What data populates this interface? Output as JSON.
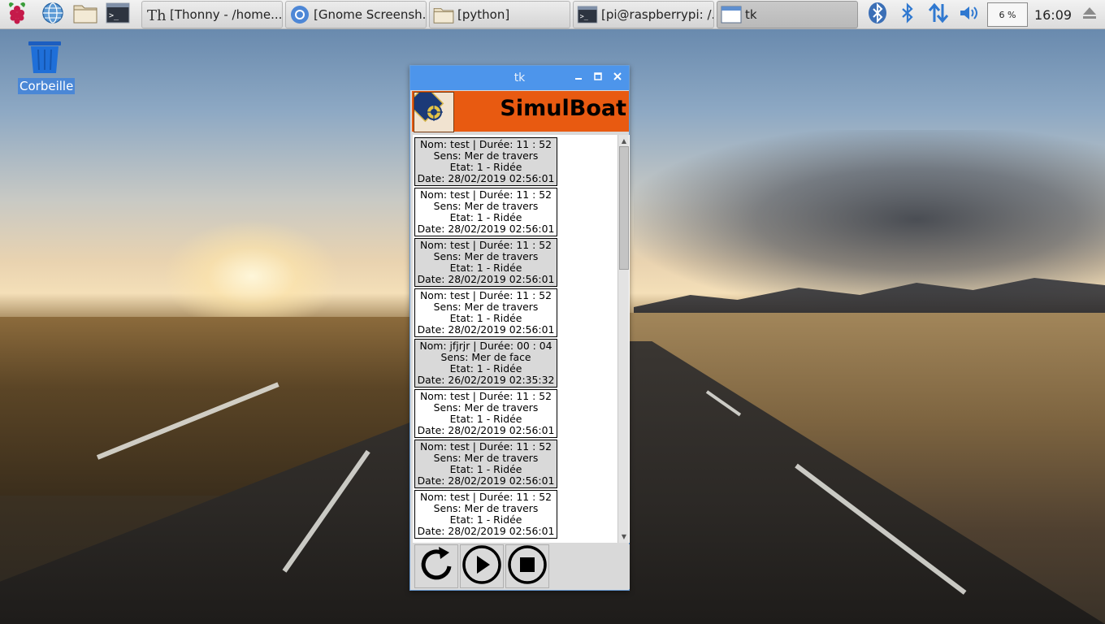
{
  "taskbar": {
    "launchers": [
      {
        "name": "raspberry-menu",
        "icon": "raspberry-icon"
      },
      {
        "name": "web-browser",
        "icon": "globe-icon"
      },
      {
        "name": "file-manager",
        "icon": "folder-icon"
      },
      {
        "name": "terminal",
        "icon": "terminal-icon"
      }
    ],
    "tasks": [
      {
        "label": "[Thonny  -  /home...",
        "icon": "thonny-icon"
      },
      {
        "label": "[Gnome Screensh...",
        "icon": "chromium-icon"
      },
      {
        "label": "[python]",
        "icon": "folder-icon"
      },
      {
        "label": "[pi@raspberrypi: /...",
        "icon": "terminal-icon"
      },
      {
        "label": "tk",
        "icon": "window-icon"
      }
    ],
    "tray": {
      "cpu_usage": "6 %",
      "clock": "16:09"
    }
  },
  "desktop": {
    "icons": [
      {
        "label": "Corbeille",
        "icon": "trash-icon"
      }
    ]
  },
  "window": {
    "title": "tk",
    "app_title": "SimulBoat",
    "entries": [
      {
        "nom": "Nom: test  | Durée: 11 : 52",
        "sens": "Sens: Mer de travers",
        "etat": "Etat: 1 - Ridée",
        "date": "Date: 28/02/2019 02:56:01"
      },
      {
        "nom": "Nom: test  | Durée: 11 : 52",
        "sens": "Sens: Mer de travers",
        "etat": "Etat: 1 - Ridée",
        "date": "Date: 28/02/2019 02:56:01"
      },
      {
        "nom": "Nom: test  | Durée: 11 : 52",
        "sens": "Sens: Mer de travers",
        "etat": "Etat: 1 - Ridée",
        "date": "Date: 28/02/2019 02:56:01"
      },
      {
        "nom": "Nom: test  | Durée: 11 : 52",
        "sens": "Sens: Mer de travers",
        "etat": "Etat: 1 - Ridée",
        "date": "Date: 28/02/2019 02:56:01"
      },
      {
        "nom": "Nom: jfjrjr | Durée: 00 : 04",
        "sens": "Sens: Mer de face",
        "etat": "Etat: 1 - Ridée",
        "date": "Date: 26/02/2019 02:35:32"
      },
      {
        "nom": "Nom: test  | Durée: 11 : 52",
        "sens": "Sens: Mer de travers",
        "etat": "Etat: 1 - Ridée",
        "date": "Date: 28/02/2019 02:56:01"
      },
      {
        "nom": "Nom: test  | Durée: 11 : 52",
        "sens": "Sens: Mer de travers",
        "etat": "Etat: 1 - Ridée",
        "date": "Date: 28/02/2019 02:56:01"
      },
      {
        "nom": "Nom: test  | Durée: 11 : 52",
        "sens": "Sens: Mer de travers",
        "etat": "Etat: 1 - Ridée",
        "date": "Date: 28/02/2019 02:56:01"
      }
    ],
    "controls": [
      {
        "name": "refresh",
        "icon": "refresh-icon"
      },
      {
        "name": "play",
        "icon": "play-icon"
      },
      {
        "name": "stop",
        "icon": "stop-icon"
      }
    ]
  },
  "colors": {
    "banner": "#e85a11",
    "titlebar": "#4d95eb",
    "entry_alt": "#d9d9d9"
  }
}
